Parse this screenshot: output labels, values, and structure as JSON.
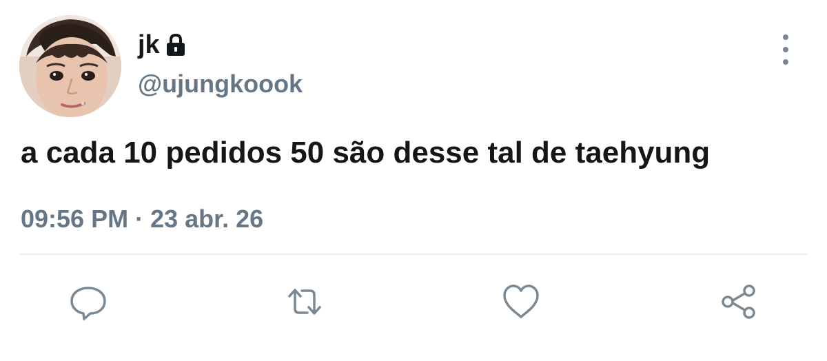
{
  "user": {
    "display_name": "jk",
    "handle": "@ujungkoook",
    "protected": true,
    "avatar": "profile-photo"
  },
  "tweet": {
    "text": "a cada 10 pedidos 50 são desse tal de taehyung",
    "timestamp": "09:56 PM · 23 abr. 26"
  },
  "actions": [
    {
      "name": "reply",
      "icon": "speech-bubble-icon"
    },
    {
      "name": "retweet",
      "icon": "retweet-arrows-icon"
    },
    {
      "name": "like",
      "icon": "heart-icon"
    },
    {
      "name": "share",
      "icon": "share-nodes-icon"
    }
  ],
  "menu": {
    "icon": "vertical-dots-icon"
  },
  "colors": {
    "text": "#14171a",
    "secondary": "#657786",
    "divider": "#e6ecf0",
    "icon": "#7a8894"
  }
}
